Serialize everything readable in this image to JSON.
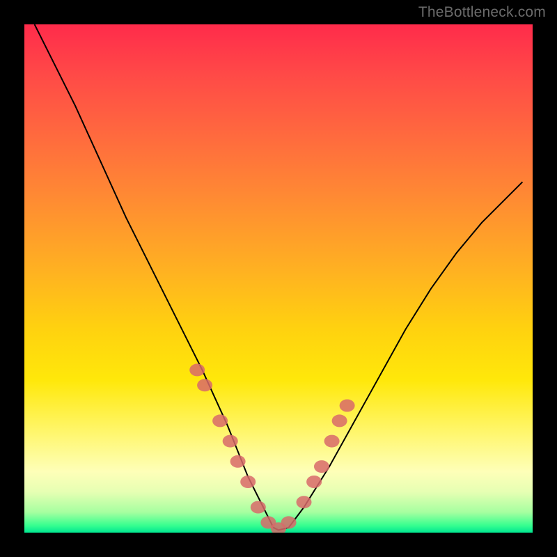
{
  "watermark": "TheBottleneck.com",
  "chart_data": {
    "type": "line",
    "title": "",
    "xlabel": "",
    "ylabel": "",
    "xlim": [
      0,
      100
    ],
    "ylim": [
      0,
      100
    ],
    "grid": false,
    "series": [
      {
        "name": "bottleneck-curve",
        "x": [
          2,
          5,
          10,
          15,
          20,
          25,
          30,
          35,
          40,
          44,
          47,
          49,
          50,
          52,
          55,
          60,
          65,
          70,
          75,
          80,
          85,
          90,
          95,
          98
        ],
        "values": [
          100,
          94,
          84,
          73,
          62,
          52,
          42,
          32,
          21,
          11,
          5,
          1,
          0.5,
          1,
          5,
          13,
          22,
          31,
          40,
          48,
          55,
          61,
          66,
          69
        ]
      }
    ],
    "markers": {
      "name": "highlight-points",
      "shape": "circle",
      "color": "#d86a6a",
      "x": [
        34,
        35.5,
        38.5,
        40.5,
        42,
        44,
        46,
        48,
        50,
        52,
        55,
        57,
        58.5,
        60.5,
        62,
        63.5
      ],
      "values": [
        32,
        29,
        22,
        18,
        14,
        10,
        5,
        2,
        0.8,
        2,
        6,
        10,
        13,
        18,
        22,
        25
      ]
    },
    "background_gradient": {
      "top": "#ff2b4b",
      "mid": "#ffd20f",
      "bottom": "#00e790"
    }
  }
}
